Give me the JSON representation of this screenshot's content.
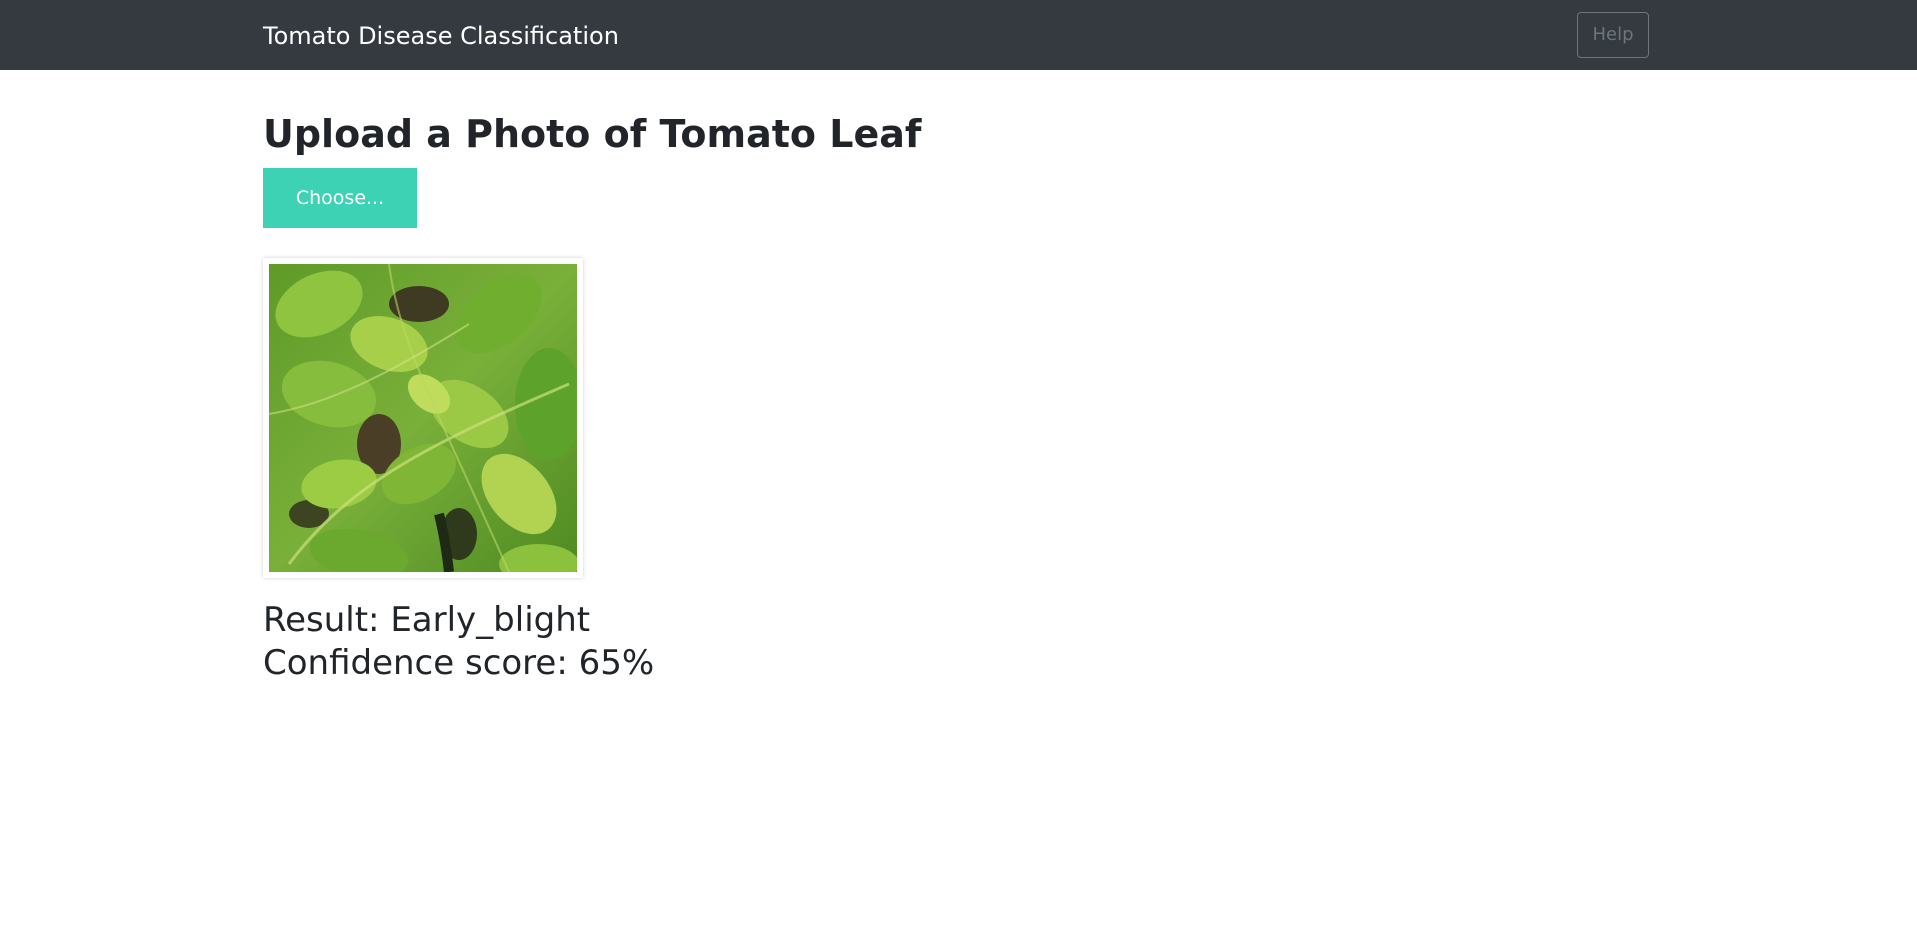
{
  "navbar": {
    "brand": "Tomato Disease Classification",
    "help_label": "Help"
  },
  "main": {
    "title": "Upload a Photo of Tomato Leaf",
    "choose_label": "Choose...",
    "preview_image": "tomato-leaf-photo",
    "result_text": "Result: Early_blight",
    "confidence_text": "Confidence score: 65%"
  },
  "colors": {
    "navbar_bg": "#343a40",
    "accent": "#3dd2b4",
    "text": "#212529",
    "muted": "#6c757d"
  }
}
